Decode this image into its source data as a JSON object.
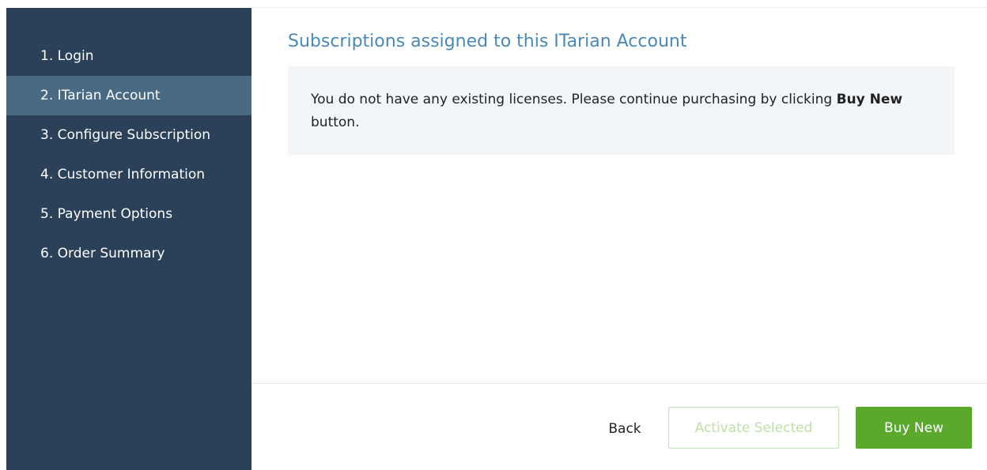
{
  "sidebar": {
    "items": [
      {
        "label": "1. Login",
        "active": false
      },
      {
        "label": "2. ITarian Account",
        "active": true
      },
      {
        "label": "3. Configure Subscription",
        "active": false
      },
      {
        "label": "4. Customer Information",
        "active": false
      },
      {
        "label": "5. Payment Options",
        "active": false
      },
      {
        "label": "6. Order Summary",
        "active": false
      }
    ]
  },
  "main": {
    "title": "Subscriptions assigned to this ITarian Account",
    "notice": {
      "text_before": "You do not have any existing licenses. Please continue purchasing by clicking ",
      "bold": "Buy New",
      "text_after": " button."
    }
  },
  "footer": {
    "back_label": "Back",
    "activate_label": "Activate Selected",
    "buy_label": "Buy New"
  },
  "colors": {
    "sidebar_bg": "#2b4159",
    "sidebar_active_bg": "#4a6983",
    "title": "#4a89b6",
    "notice_bg": "#f2f6f9",
    "primary_green": "#5aa92c",
    "disabled_green": "#bfe0a8"
  }
}
